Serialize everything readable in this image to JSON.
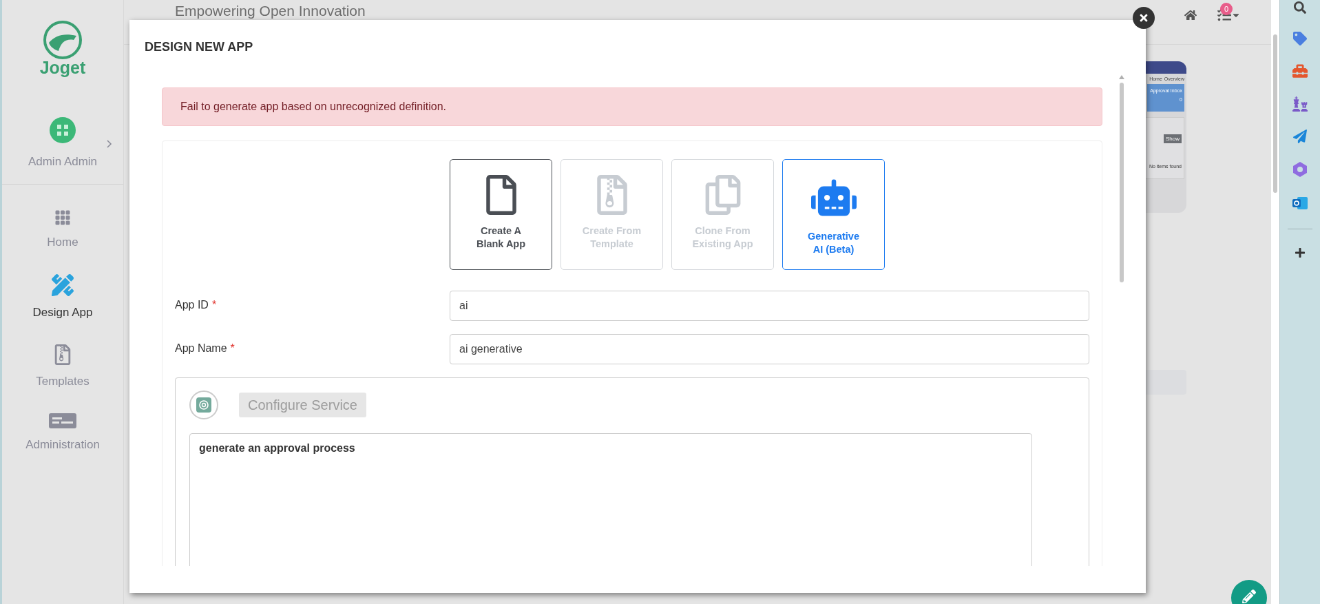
{
  "header": {
    "title": "Empowering Open Innovation",
    "notification_count": "0"
  },
  "sidebar": {
    "logo_text": "Joget",
    "user": "Admin Admin",
    "items": [
      {
        "label": "Home",
        "kind": "home",
        "selected": false
      },
      {
        "label": "Design App",
        "kind": "design",
        "selected": true
      },
      {
        "label": "Templates",
        "kind": "templates",
        "selected": false
      },
      {
        "label": "Administration",
        "kind": "admin",
        "selected": false
      }
    ]
  },
  "background_preview": {
    "breadcrumb": [
      "Home",
      "Overview"
    ],
    "inbox_label": "Approval Inbox",
    "inbox_count": "0",
    "button": "Show",
    "empty_text": "No items found"
  },
  "dialog": {
    "title": "DESIGN NEW APP",
    "alert": "Fail to generate app based on unrecognized definition.",
    "options": [
      {
        "kind": "blank",
        "label": "Create A\nBlank App",
        "selected": false,
        "disabled": false
      },
      {
        "kind": "template",
        "label": "Create From\nTemplate",
        "selected": false,
        "disabled": true
      },
      {
        "kind": "clone",
        "label": "Clone From\nExisting App",
        "selected": false,
        "disabled": true
      },
      {
        "kind": "ai",
        "label": "Generative\nAI (Beta)",
        "selected": true,
        "disabled": false
      }
    ],
    "fields": [
      {
        "label": "App ID",
        "required_mark": "*",
        "value": "ai"
      },
      {
        "label": "App Name",
        "required_mark": "*",
        "value": "ai generative"
      }
    ],
    "ai_panel": {
      "service_button": "Configure Service",
      "prompt": "generate an approval process"
    }
  }
}
